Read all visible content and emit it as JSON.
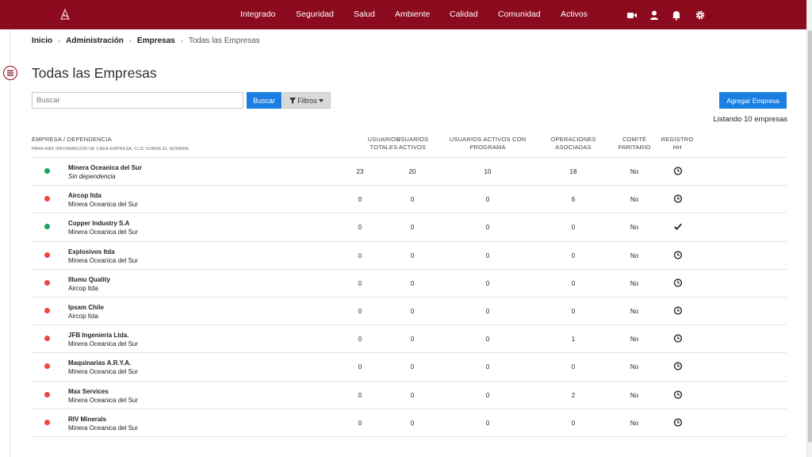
{
  "nav": {
    "items": [
      "Integrado",
      "Seguridad",
      "Salud",
      "Ambiente",
      "Calidad",
      "Comunidad",
      "Activos"
    ],
    "icons": [
      "video-camera-icon",
      "user-icon",
      "bell-icon",
      "gear-icon"
    ]
  },
  "breadcrumb": {
    "items": [
      "Inicio",
      "Administración",
      "Empresas"
    ],
    "current": "Todas las Empresas"
  },
  "page": {
    "title": "Todas las Empresas"
  },
  "search": {
    "placeholder": "Buscar",
    "value": "",
    "button_label": "Buscar",
    "filters_label": "Filtros"
  },
  "actions": {
    "add_label": "Agregar Empresa"
  },
  "listing": {
    "count_text": "Listando 10 empresas"
  },
  "table": {
    "headers": {
      "empresa": "Empresa / Dependencia",
      "empresa_sub": "Para más información de cada empresa, clic sobre el nombre",
      "usuarios_totales": [
        "Usuarios",
        "Totales"
      ],
      "usuarios_activos": [
        "Usuarios",
        "Activos"
      ],
      "usuarios_programa": [
        "Usuarios activos con",
        "programa"
      ],
      "operaciones": [
        "Operaciones",
        "asociadas"
      ],
      "comite": [
        "Comité",
        "paritario"
      ],
      "registro": [
        "Registro",
        "HH"
      ]
    },
    "rows": [
      {
        "name": "Minera Oceanica del Sur",
        "parent": "Sin dependencia",
        "parent_italic": true,
        "status": "active",
        "totales": "23",
        "activos": "20",
        "programa": "10",
        "operaciones": "18",
        "comite": "No",
        "registro": "clock-icon"
      },
      {
        "name": "Aircop ltda",
        "parent": "Minera Oceanica del Sur",
        "parent_italic": false,
        "status": "inactive",
        "totales": "0",
        "activos": "0",
        "programa": "0",
        "operaciones": "6",
        "comite": "No",
        "registro": "clock-icon"
      },
      {
        "name": "Copper Industry S.A",
        "parent": "Minera Oceanica del Sur",
        "parent_italic": false,
        "status": "active",
        "totales": "0",
        "activos": "0",
        "programa": "0",
        "operaciones": "0",
        "comite": "No",
        "registro": "check-icon"
      },
      {
        "name": "Explosivos ltda",
        "parent": "Minera Oceanica del Sur",
        "parent_italic": false,
        "status": "inactive",
        "totales": "0",
        "activos": "0",
        "programa": "0",
        "operaciones": "0",
        "comite": "No",
        "registro": "clock-icon"
      },
      {
        "name": "Illumu Quality",
        "parent": "Aircop ltda",
        "parent_italic": false,
        "status": "inactive",
        "totales": "0",
        "activos": "0",
        "programa": "0",
        "operaciones": "0",
        "comite": "No",
        "registro": "clock-icon"
      },
      {
        "name": "Ipsam Chile",
        "parent": "Aircop ltda",
        "parent_italic": false,
        "status": "inactive",
        "totales": "0",
        "activos": "0",
        "programa": "0",
        "operaciones": "0",
        "comite": "No",
        "registro": "clock-icon"
      },
      {
        "name": "JFB Ingeniería Ltda.",
        "parent": "Minera Oceanica del Sur",
        "parent_italic": false,
        "status": "inactive",
        "totales": "0",
        "activos": "0",
        "programa": "0",
        "operaciones": "1",
        "comite": "No",
        "registro": "clock-icon"
      },
      {
        "name": "Maquinarias A.R.Y.A.",
        "parent": "Minera Oceanica del Sur",
        "parent_italic": false,
        "status": "inactive",
        "totales": "0",
        "activos": "0",
        "programa": "0",
        "operaciones": "0",
        "comite": "No",
        "registro": "clock-icon"
      },
      {
        "name": "Max Services",
        "parent": "Minera Oceanica del Sur",
        "parent_italic": false,
        "status": "inactive",
        "totales": "0",
        "activos": "0",
        "programa": "0",
        "operaciones": "2",
        "comite": "No",
        "registro": "clock-icon"
      },
      {
        "name": "RIV Minerals",
        "parent": "Minera Oceanica del Sur",
        "parent_italic": false,
        "status": "inactive",
        "totales": "0",
        "activos": "0",
        "programa": "0",
        "operaciones": "0",
        "comite": "No",
        "registro": "clock-icon"
      }
    ]
  },
  "colors": {
    "brand": "#8b0a1e",
    "primary": "#1a7fe0",
    "status_active": "#1aa35a",
    "status_inactive": "#f04545"
  }
}
